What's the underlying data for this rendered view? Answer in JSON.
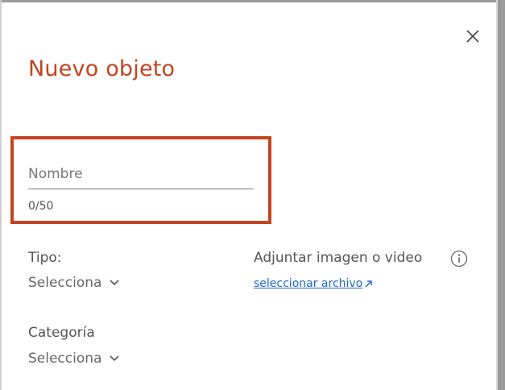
{
  "dialog": {
    "title": "Nuevo objeto",
    "close_icon": "close-icon",
    "accent_color": "#c24420"
  },
  "name_field": {
    "placeholder": "Nombre",
    "value": "",
    "counter": "0/50"
  },
  "tipo": {
    "label": "Tipo:",
    "selected": "Selecciona"
  },
  "categoria": {
    "label": "Categoría",
    "selected": "Selecciona"
  },
  "attachment": {
    "label": "Adjuntar imagen o video",
    "info_icon": "info-icon",
    "link_label": "seleccionar archivo",
    "link_icon": "external-link-icon",
    "link_color": "#2266cc"
  }
}
